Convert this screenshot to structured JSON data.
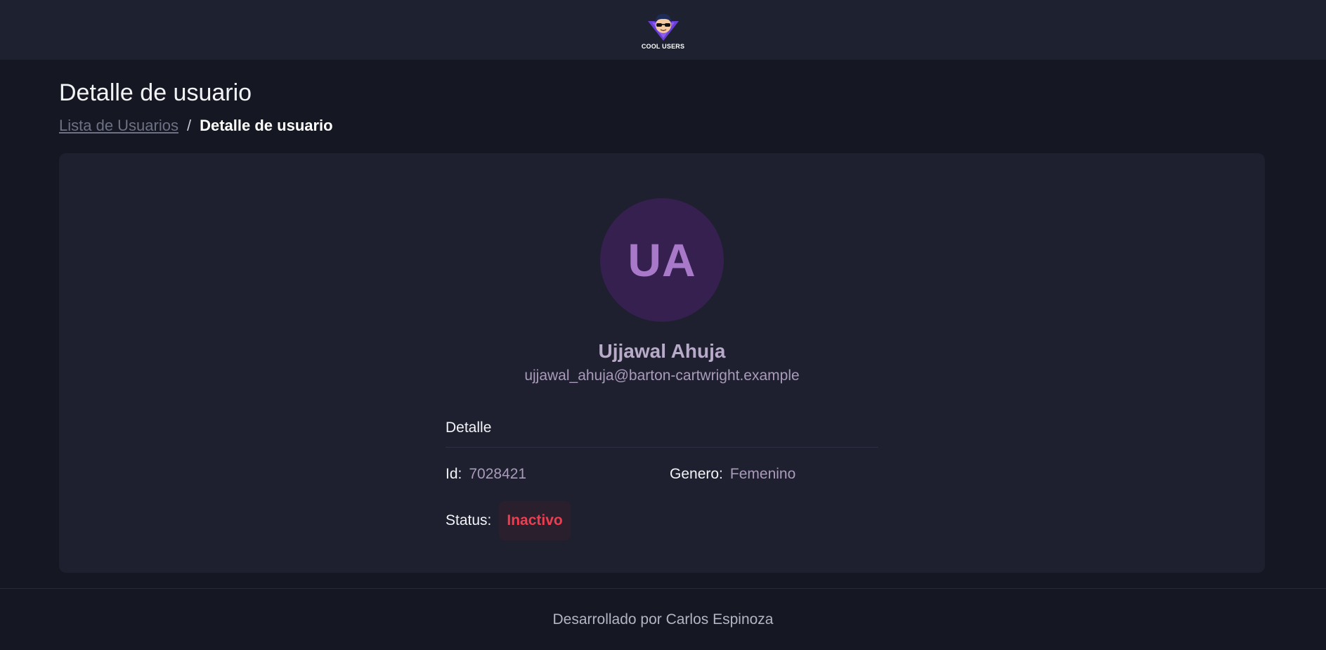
{
  "header": {
    "logo_text": "COOL USERS",
    "logo_icon": "cool-user-mascot-icon"
  },
  "page": {
    "title": "Detalle de usuario"
  },
  "breadcrumb": {
    "parent_label": "Lista de Usuarios",
    "separator": "/",
    "current_label": "Detalle de usuario"
  },
  "user": {
    "initials": "UA",
    "name": "Ujjawal Ahuja",
    "email": "ujjawal_ahuja@barton-cartwright.example"
  },
  "details": {
    "heading": "Detalle",
    "id_label": "Id:",
    "id_value": "7028421",
    "gender_label": "Genero:",
    "gender_value": "Femenino",
    "status_label": "Status:",
    "status_value": "Inactivo"
  },
  "footer": {
    "text": "Desarrollado por Carlos Espinoza"
  },
  "colors": {
    "background": "#151822",
    "header": "#1e2130",
    "card": "#1e2030",
    "avatar_bg": "#35204f",
    "avatar_text": "#a879c9",
    "status_inactive": "#ef3d4f"
  }
}
